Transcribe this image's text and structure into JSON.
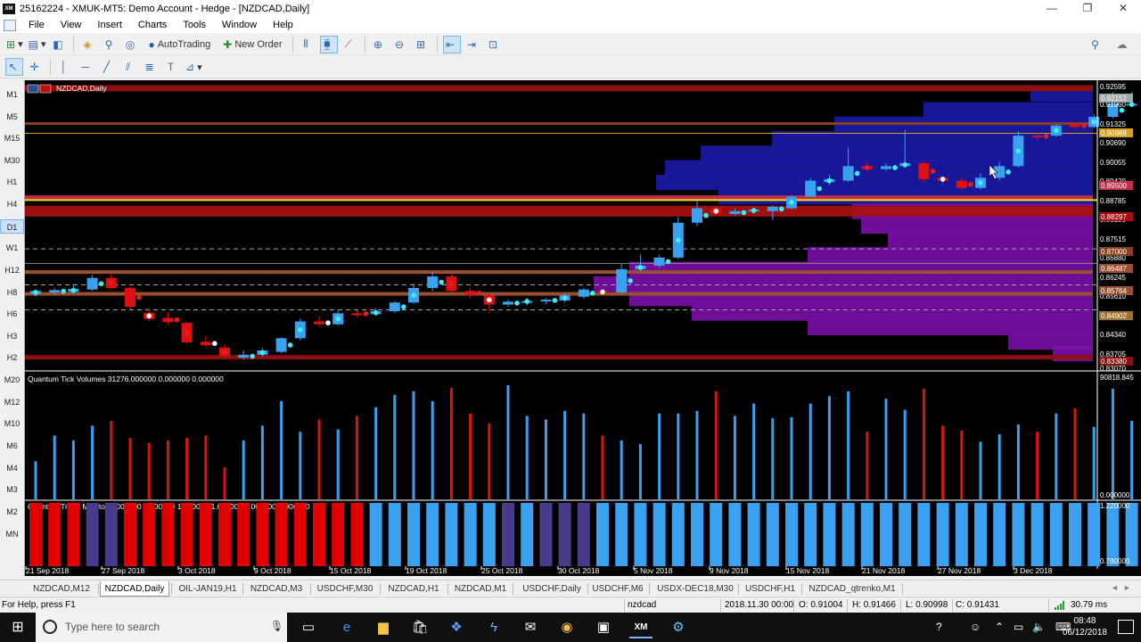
{
  "window": {
    "title": "25162224 - XMUK-MT5: Demo Account - Hedge - [NZDCAD,Daily]",
    "app_icon_label": "XM",
    "controls": [
      "minimize-icon",
      "restore-icon",
      "close-icon"
    ]
  },
  "menu": [
    "File",
    "View",
    "Insert",
    "Charts",
    "Tools",
    "Window",
    "Help"
  ],
  "toolbar": {
    "autotrading_label": "AutoTrading",
    "new_order_label": "New Order"
  },
  "timeframes": [
    "M1",
    "M5",
    "M15",
    "M30",
    "H1",
    "H4",
    "D1",
    "W1",
    "H12",
    "H8",
    "H6",
    "H3",
    "H2",
    "M20",
    "M12",
    "M10",
    "M6",
    "M4",
    "M3",
    "M2",
    "MN"
  ],
  "active_timeframe": "D1",
  "chart": {
    "symbol_label": "NZDCAD,Daily",
    "price_axis": [
      "0.92595",
      "0.91960",
      "0.91325",
      "0.90690",
      "0.90055",
      "0.89420",
      "0.88785",
      "0.88150",
      "0.87515",
      "0.86880",
      "0.86245",
      "0.85610",
      "0.84975",
      "0.84340",
      "0.83705",
      "0.83070"
    ],
    "price_tags": [
      "0.92152",
      "0.90988",
      "0.89500",
      "0.88297",
      "0.87000",
      "0.86487",
      "0.85764",
      "0.84902",
      "0.83380"
    ],
    "x_axis": [
      "21 Sep 2018",
      "27 Sep 2018",
      "3 Oct 2018",
      "9 Oct 2018",
      "15 Oct 2018",
      "19 Oct 2018",
      "25 Oct 2018",
      "30 Oct 2018",
      "5 Nov 2018",
      "9 Nov 2018",
      "15 Nov 2018",
      "21 Nov 2018",
      "27 Nov 2018",
      "3 Dec 2018"
    ],
    "colors": {
      "background": "#000000",
      "bull": "#3aa0f0",
      "bear": "#e01010",
      "profile": "#1a1aa8",
      "purple": "#7a10a8"
    }
  },
  "volume_panel": {
    "label": "Quantum Tick Volumes 31276.000000 0.000000 0.000000",
    "scale_top": "90818.845",
    "scale_bottom": "0.000000"
  },
  "trend_panel": {
    "label": "Quantum Trend Monitor 1.000000 1.000000 1.000000 1.000000 1.000000 0.000000",
    "scale_top": "1.220000",
    "scale_bottom": "0.780000"
  },
  "chart_data": {
    "type": "candlestick",
    "title": "NZDCAD,Daily",
    "ylim": [
      0.8307,
      0.92595
    ],
    "candles": [
      {
        "o": 0.8545,
        "c": 0.8555,
        "h": 0.856,
        "l": 0.8535
      },
      {
        "o": 0.855,
        "c": 0.8558,
        "h": 0.8565,
        "l": 0.854
      },
      {
        "o": 0.8552,
        "c": 0.8562,
        "h": 0.858,
        "l": 0.8545
      },
      {
        "o": 0.856,
        "c": 0.86,
        "h": 0.861,
        "l": 0.8555
      },
      {
        "o": 0.86,
        "c": 0.8565,
        "h": 0.8615,
        "l": 0.856
      },
      {
        "o": 0.8565,
        "c": 0.85,
        "h": 0.857,
        "l": 0.849
      },
      {
        "o": 0.848,
        "c": 0.8458,
        "h": 0.8495,
        "l": 0.845
      },
      {
        "o": 0.8462,
        "c": 0.8448,
        "h": 0.848,
        "l": 0.844
      },
      {
        "o": 0.8445,
        "c": 0.8378,
        "h": 0.845,
        "l": 0.8372
      },
      {
        "o": 0.838,
        "c": 0.8368,
        "h": 0.84,
        "l": 0.836
      },
      {
        "o": 0.836,
        "c": 0.833,
        "h": 0.837,
        "l": 0.8322
      },
      {
        "o": 0.8325,
        "c": 0.8335,
        "h": 0.835,
        "l": 0.8318
      },
      {
        "o": 0.8335,
        "c": 0.835,
        "h": 0.8358,
        "l": 0.8328
      },
      {
        "o": 0.8345,
        "c": 0.8392,
        "h": 0.8395,
        "l": 0.834
      },
      {
        "o": 0.8392,
        "c": 0.845,
        "h": 0.846,
        "l": 0.8385
      },
      {
        "o": 0.845,
        "c": 0.844,
        "h": 0.847,
        "l": 0.843
      },
      {
        "o": 0.844,
        "c": 0.8478,
        "h": 0.849,
        "l": 0.8435
      },
      {
        "o": 0.8478,
        "c": 0.8475,
        "h": 0.8488,
        "l": 0.8465
      },
      {
        "o": 0.8475,
        "c": 0.8485,
        "h": 0.8495,
        "l": 0.847
      },
      {
        "o": 0.8485,
        "c": 0.8515,
        "h": 0.852,
        "l": 0.848
      },
      {
        "o": 0.8515,
        "c": 0.8565,
        "h": 0.858,
        "l": 0.851
      },
      {
        "o": 0.8565,
        "c": 0.8605,
        "h": 0.862,
        "l": 0.8555
      },
      {
        "o": 0.8605,
        "c": 0.8555,
        "h": 0.8612,
        "l": 0.855
      },
      {
        "o": 0.8555,
        "c": 0.854,
        "h": 0.8565,
        "l": 0.853
      },
      {
        "o": 0.854,
        "c": 0.8508,
        "h": 0.8548,
        "l": 0.848
      },
      {
        "o": 0.8508,
        "c": 0.8518,
        "h": 0.8525,
        "l": 0.85
      },
      {
        "o": 0.8518,
        "c": 0.852,
        "h": 0.853,
        "l": 0.8505
      },
      {
        "o": 0.852,
        "c": 0.8525,
        "h": 0.853,
        "l": 0.851
      },
      {
        "o": 0.8522,
        "c": 0.854,
        "h": 0.8545,
        "l": 0.8515
      },
      {
        "o": 0.8535,
        "c": 0.856,
        "h": 0.8565,
        "l": 0.853
      },
      {
        "o": 0.8555,
        "c": 0.8548,
        "h": 0.8565,
        "l": 0.854
      },
      {
        "o": 0.855,
        "c": 0.863,
        "h": 0.865,
        "l": 0.8545
      },
      {
        "o": 0.863,
        "c": 0.8642,
        "h": 0.868,
        "l": 0.862
      },
      {
        "o": 0.8642,
        "c": 0.867,
        "h": 0.868,
        "l": 0.8635
      },
      {
        "o": 0.867,
        "c": 0.879,
        "h": 0.881,
        "l": 0.8665
      },
      {
        "o": 0.879,
        "c": 0.884,
        "h": 0.8865,
        "l": 0.878
      },
      {
        "o": 0.884,
        "c": 0.882,
        "h": 0.885,
        "l": 0.8815
      },
      {
        "o": 0.882,
        "c": 0.883,
        "h": 0.884,
        "l": 0.8815
      },
      {
        "o": 0.883,
        "c": 0.8835,
        "h": 0.884,
        "l": 0.882
      },
      {
        "o": 0.883,
        "c": 0.8845,
        "h": 0.885,
        "l": 0.88
      },
      {
        "o": 0.884,
        "c": 0.888,
        "h": 0.8885,
        "l": 0.8835
      },
      {
        "o": 0.888,
        "c": 0.8935,
        "h": 0.8945,
        "l": 0.8875
      },
      {
        "o": 0.893,
        "c": 0.894,
        "h": 0.8955,
        "l": 0.892
      },
      {
        "o": 0.8935,
        "c": 0.8985,
        "h": 0.905,
        "l": 0.893
      },
      {
        "o": 0.8985,
        "c": 0.8975,
        "h": 0.9,
        "l": 0.8965
      },
      {
        "o": 0.8975,
        "c": 0.8985,
        "h": 0.8995,
        "l": 0.897
      },
      {
        "o": 0.8985,
        "c": 0.8995,
        "h": 0.911,
        "l": 0.898
      },
      {
        "o": 0.8995,
        "c": 0.894,
        "h": 0.9,
        "l": 0.893
      },
      {
        "o": 0.8945,
        "c": 0.8935,
        "h": 0.895,
        "l": 0.892
      },
      {
        "o": 0.8935,
        "c": 0.891,
        "h": 0.8945,
        "l": 0.8905
      },
      {
        "o": 0.891,
        "c": 0.8945,
        "h": 0.896,
        "l": 0.8905
      },
      {
        "o": 0.8945,
        "c": 0.8985,
        "h": 0.9,
        "l": 0.8935
      },
      {
        "o": 0.8985,
        "c": 0.909,
        "h": 0.9105,
        "l": 0.898
      },
      {
        "o": 0.909,
        "c": 0.9085,
        "h": 0.91,
        "l": 0.9075
      },
      {
        "o": 0.909,
        "c": 0.9125,
        "h": 0.913,
        "l": 0.9085
      },
      {
        "o": 0.913,
        "c": 0.912,
        "h": 0.9135,
        "l": 0.911
      },
      {
        "o": 0.912,
        "c": 0.9155,
        "h": 0.9165,
        "l": 0.9115
      },
      {
        "o": 0.9155,
        "c": 0.92,
        "h": 0.924,
        "l": 0.915
      },
      {
        "o": 0.9195,
        "c": 0.92,
        "h": 0.924,
        "l": 0.919
      }
    ],
    "volumes": [
      31000,
      52000,
      48000,
      60000,
      64000,
      50000,
      46000,
      48000,
      50000,
      52000,
      26000,
      48000,
      60000,
      80000,
      55000,
      65000,
      57000,
      68000,
      75000,
      85000,
      88000,
      80000,
      90818,
      70000,
      62000,
      93000,
      68000,
      65000,
      72000,
      70000,
      52000,
      48000,
      45000,
      70000,
      70000,
      72000,
      88000,
      68000,
      78000,
      66000,
      67000,
      78000,
      84000,
      88000,
      55000,
      82000,
      73000,
      90000,
      60000,
      56000,
      47000,
      53000,
      61000,
      55000,
      70000,
      74000,
      59000,
      90000,
      64000,
      60000
    ],
    "trend": [
      0,
      0,
      0,
      2,
      2,
      0,
      0,
      0,
      0,
      0,
      0,
      0,
      0,
      0,
      0,
      0,
      0,
      0,
      1,
      1,
      1,
      1,
      1,
      1,
      1,
      2,
      1,
      2,
      2,
      2,
      1,
      1,
      1,
      1,
      1,
      1,
      1,
      1,
      1,
      1,
      1,
      1,
      1,
      1,
      1,
      1,
      1,
      1,
      1,
      1,
      1,
      1,
      1,
      1,
      1,
      1,
      1,
      1,
      1
    ]
  },
  "tabs": [
    "NZDCAD,M12",
    "NZDCAD,Daily",
    "OIL-JAN19,H1",
    "NZDCAD,M3",
    "USDCHF,M30",
    "NZDCAD,H1",
    "NZDCAD,M1",
    "USDCHF,Daily",
    "USDCHF,M6",
    "USDX-DEC18,M30",
    "USDCHF,H1",
    "NZDCAD_qtrenko,M1"
  ],
  "active_tab": "NZDCAD,Daily",
  "status": {
    "help": "For Help, press F1",
    "symbol": "nzdcad",
    "time": "2018.11.30 00:00",
    "open": "O: 0.91004",
    "high": "H: 0.91466",
    "low": "L: 0.90998",
    "close": "C: 0.91431",
    "ping": "30.79 ms"
  },
  "taskbar": {
    "search_placeholder": "Type here to search",
    "time": "08:48",
    "date": "06/12/2018"
  }
}
